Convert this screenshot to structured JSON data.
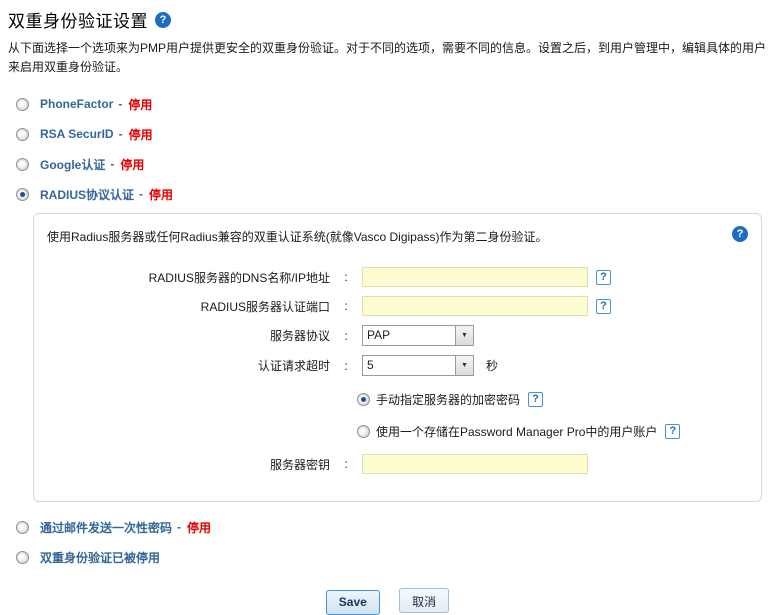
{
  "page": {
    "title": "双重身份验证设置",
    "description": "从下面选择一个选项来为PMP用户提供更安全的双重身份验证。对于不同的选项，需要不同的信息。设置之后，到用户管理中，编辑具体的用户来启用双重身份验证。"
  },
  "icons": {
    "help": "?",
    "dropdown_arrow": "▼"
  },
  "options": [
    {
      "label": "PhoneFactor",
      "dash": "-",
      "status": "停用",
      "selected": false
    },
    {
      "label": "RSA SecurID",
      "dash": "-",
      "status": "停用",
      "selected": false
    },
    {
      "label": "Google认证",
      "dash": "-",
      "status": "停用",
      "selected": false
    },
    {
      "label": "RADIUS协议认证",
      "dash": "-",
      "status": "停用",
      "selected": true
    },
    {
      "label": "通过邮件发送一次性密码",
      "dash": "-",
      "status": "停用",
      "selected": false
    },
    {
      "label": "双重身份验证已被停用",
      "dash": "",
      "status": "",
      "selected": false
    }
  ],
  "radius_panel": {
    "description": "使用Radius服务器或任何Radius兼容的双重认证系统(就像Vasco Digipass)作为第二身份验证。",
    "colon": ":",
    "dns_label": "RADIUS服务器的DNS名称/IP地址",
    "dns_value": "",
    "port_label": "RADIUS服务器认证端口",
    "port_value": "",
    "protocol_label": "服务器协议",
    "protocol_value": "PAP",
    "timeout_label": "认证请求超时",
    "timeout_value": "5",
    "timeout_unit": "秒",
    "secret_label": "服务器密钥",
    "secret_value": "",
    "auth_options": [
      {
        "label": "手动指定服务器的加密密码",
        "selected": true
      },
      {
        "label": "使用一个存储在Password Manager Pro中的用户账户",
        "selected": false
      }
    ]
  },
  "buttons": {
    "save": "Save",
    "cancel": "取消"
  },
  "colors": {
    "option_label_blue": "#336699",
    "status_red": "#e60000",
    "help_icon_blue": "#1d6ec0",
    "input_yellow": "#fdfdd1",
    "panel_border": "#d6d6d6",
    "save_border_blue": "#4d90c8"
  }
}
